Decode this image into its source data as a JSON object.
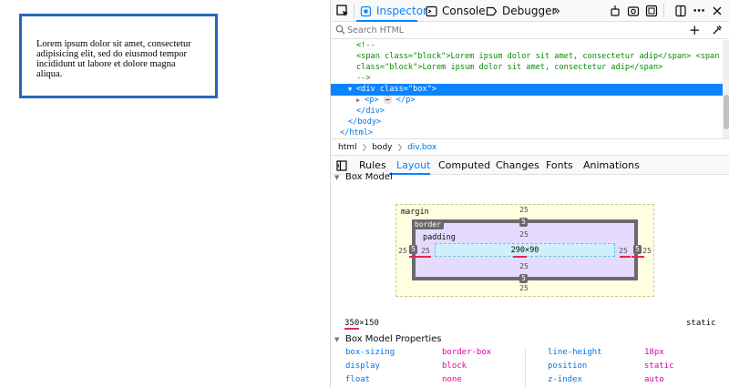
{
  "page": {
    "paragraph": "Lorem ipsum dolor sit amet, consectetur adipisicing elit, sed do eiusmod tempor incididunt ut labore et dolore magna aliqua."
  },
  "devtools": {
    "tabs": {
      "inspector": "Inspector",
      "console": "Console",
      "debugger": "Debugger"
    },
    "search": {
      "placeholder": "Search HTML"
    },
    "markup": {
      "l1": "<!--",
      "l2_tag_open": "<span ",
      "l2_attr": "class=",
      "l2_val": "\"block\"",
      "l2_text": ">Lorem ipsum dolor sit amet, consectetur adip</span> <span",
      "l3_attr": "class=",
      "l3_val": "\"block\"",
      "l3_text": ">Lorem ipsum dolor sit amet, consectetur adip</span>",
      "l4": "-->",
      "l5_tag": "<div ",
      "l5_attr": "class=",
      "l5_val": "\"box\"",
      "l5_close": ">",
      "l6_open": "<p>",
      "l6_close": "</p>",
      "l7": "</div>",
      "l8": "</body>",
      "l9": "</html>"
    },
    "breadcrumbs": [
      "html",
      "body",
      "div.box"
    ],
    "sidebar_tabs": {
      "rules": "Rules",
      "layout": "Layout",
      "computed": "Computed",
      "changes": "Changes",
      "fonts": "Fonts",
      "animations": "Animations"
    },
    "box_model": {
      "title": "Box Model",
      "margin_label": "margin",
      "border_label": "border",
      "padding_label": "padding",
      "margin": {
        "top": "25",
        "right": "25",
        "bottom": "25",
        "left": "25"
      },
      "border": {
        "top": "5",
        "right": "5",
        "bottom": "5",
        "left": "5"
      },
      "padding": {
        "top": "25",
        "right": "25",
        "bottom": "25",
        "left": "25"
      },
      "content": "290×90",
      "dimensions_width": "350",
      "dimensions_rest": "×150",
      "position": "static"
    },
    "properties": {
      "title": "Box Model Properties",
      "rows": [
        {
          "n1": "box-sizing",
          "v1": "border-box",
          "n2": "line-height",
          "v2": "18px"
        },
        {
          "n1": "display",
          "v1": "block",
          "n2": "position",
          "v2": "static"
        },
        {
          "n1": "float",
          "v1": "none",
          "n2": "z-index",
          "v2": "auto"
        }
      ]
    }
  }
}
